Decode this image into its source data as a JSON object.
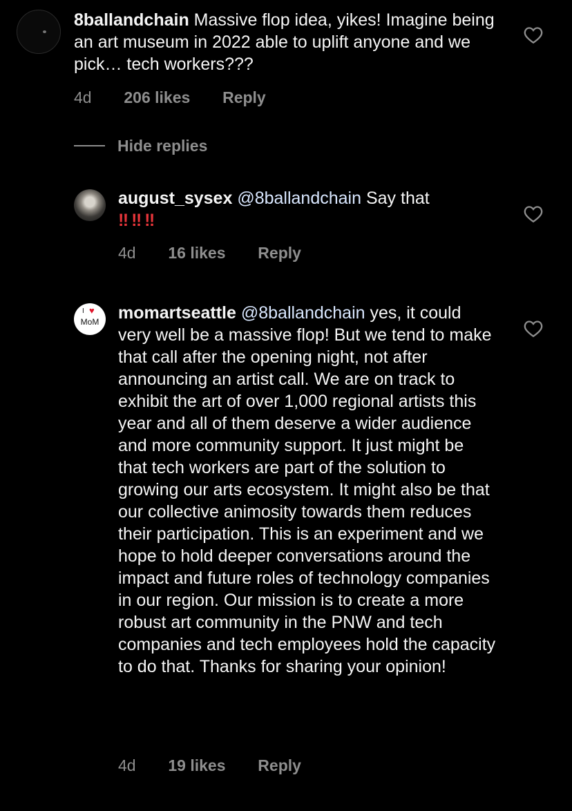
{
  "comments": [
    {
      "username": "8ballandchain",
      "text": "Massive flop idea, yikes! Imagine being an art museum in 2022 able to uplift anyone and we pick… tech workers???",
      "age": "4d",
      "likes": "206 likes",
      "reply": "Reply",
      "avatar_icon": "dark-profile-avatar",
      "like_icon": "heart-outline-icon"
    }
  ],
  "hide_replies_label": "Hide replies",
  "replies": [
    {
      "username": "august_sysex",
      "mention": "@8ballandchain",
      "text": "Say that",
      "emoji": [
        "‼",
        "‼",
        "‼"
      ],
      "age": "4d",
      "likes": "16 likes",
      "reply": "Reply",
      "avatar_icon": "figure-photo-avatar",
      "like_icon": "heart-outline-icon"
    },
    {
      "username": "momartseattle",
      "mention": "@8ballandchain",
      "text": "yes, it could very well be a massive flop! But we tend to make that call after the opening night, not after announcing an artist call. We are on track to exhibit the art of over 1,000 regional artists this year and all of them deserve a wider audience and more community support. It just might be that tech workers are part of the solution to growing our arts ecosystem. It might also be that our collective animosity towards them reduces their participation. This is an experiment and we hope to hold deeper conversations around the impact and future roles of technology companies in our region. Our mission is to create a more robust art community in the PNW and tech companies and tech employees hold the capacity to do that. Thanks for sharing your opinion!",
      "age": "4d",
      "likes": "19 likes",
      "reply": "Reply",
      "avatar_icon": "museum-logo-avatar",
      "avatar_logo_i": "I",
      "avatar_logo_heart": "♥",
      "avatar_logo_text": "MoM",
      "like_icon": "heart-outline-icon"
    }
  ],
  "colors": {
    "background": "#000000",
    "text": "#f5f5f5",
    "meta": "#8e8e8e",
    "mention": "#d9e7ff",
    "emoji_red": "#e6353a"
  }
}
